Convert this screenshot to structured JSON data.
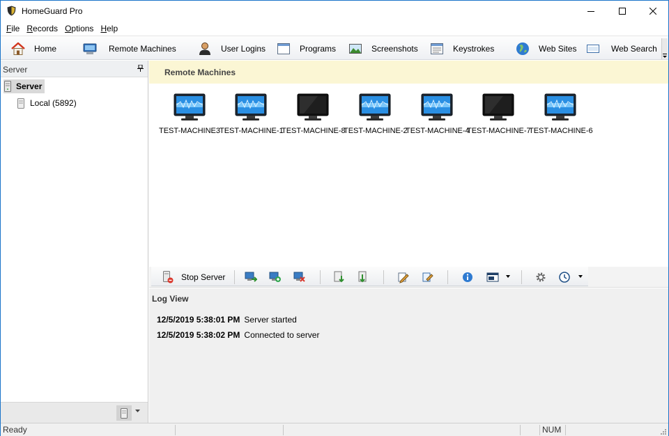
{
  "app": {
    "title": "HomeGuard Pro",
    "accent_color": "#1a74c9",
    "icon": "shield-icon"
  },
  "menu": {
    "items": [
      {
        "label": "File",
        "accel": "F",
        "rest": "ile"
      },
      {
        "label": "Records",
        "accel": "R",
        "rest": "ecords"
      },
      {
        "label": "Options",
        "accel": "O",
        "rest": "ptions"
      },
      {
        "label": "Help",
        "accel": "H",
        "rest": "elp"
      }
    ]
  },
  "toolbar": {
    "items": [
      {
        "label": "Home",
        "icon": "home-icon"
      },
      {
        "label": "Remote Machines",
        "icon": "remote-machines-icon"
      },
      {
        "label": "User Logins",
        "icon": "user-icon"
      },
      {
        "label": "Programs",
        "icon": "window-icon"
      },
      {
        "label": "Screenshots",
        "icon": "picture-icon"
      },
      {
        "label": "Keystrokes",
        "icon": "keyboard-icon"
      },
      {
        "label": "Web Sites",
        "icon": "globe-icon"
      },
      {
        "label": "Web Search",
        "icon": "search-box-icon"
      }
    ]
  },
  "left_pane": {
    "title": "Server",
    "tree": {
      "root": "Server",
      "children": [
        "Local (5892)"
      ]
    }
  },
  "remote_machines": {
    "header": "Remote Machines",
    "machines": [
      {
        "name": "TEST-MACHINE3",
        "online": true
      },
      {
        "name": "TEST-MACHINE-1",
        "online": true
      },
      {
        "name": "TEST-MACHINE-8",
        "online": false
      },
      {
        "name": "TEST-MACHINE-2",
        "online": true
      },
      {
        "name": "TEST-MACHINE-4",
        "online": true
      },
      {
        "name": "TEST-MACHINE-7",
        "online": false
      },
      {
        "name": "TEST-MACHINE-6",
        "online": true
      }
    ]
  },
  "server_toolbar": {
    "stop_label": "Stop Server"
  },
  "log_view": {
    "title": "Log View",
    "entries": [
      {
        "timestamp": "12/5/2019 5:38:01 PM",
        "message": "Server started"
      },
      {
        "timestamp": "12/5/2019 5:38:02 PM",
        "message": "Connected to server"
      }
    ]
  },
  "status_bar": {
    "status": "Ready",
    "num": "NUM"
  }
}
